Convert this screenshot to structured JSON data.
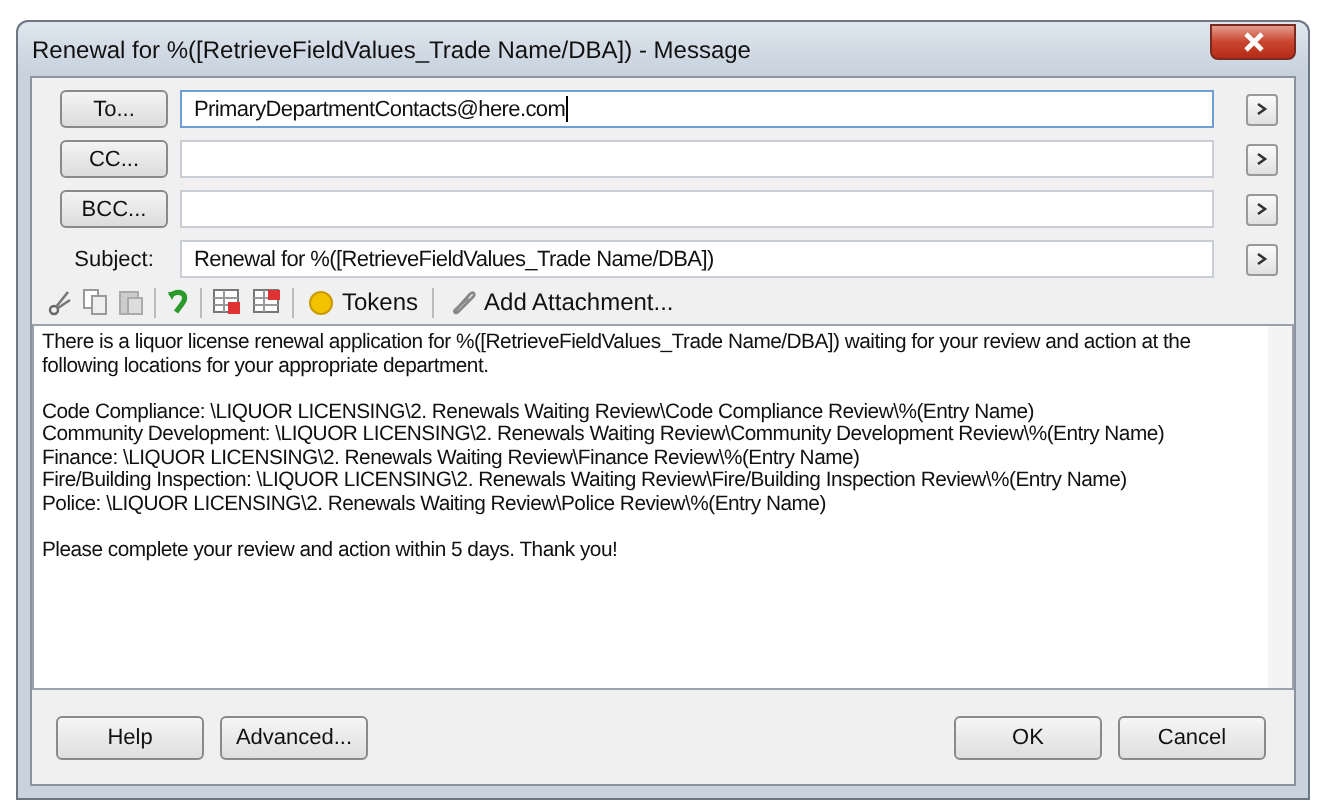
{
  "window": {
    "title": "Renewal for %([RetrieveFieldValues_Trade Name/DBA]) - Message"
  },
  "fields": [
    {
      "kind": "button",
      "label": "To...",
      "value": "PrimaryDepartmentContacts@here.com",
      "focused": true
    },
    {
      "kind": "button",
      "label": "CC...",
      "focused": false
    },
    {
      "kind": "button",
      "label": "BCC...",
      "focused": false
    },
    {
      "kind": "label",
      "label": "Subject:",
      "value": "Renewal for %([RetrieveFieldValues_Trade Name/DBA])",
      "focused": false
    }
  ],
  "toolbar": [
    {
      "kind": "tokens",
      "label": "Tokens"
    },
    {
      "kind": "attach",
      "label": "Add Attachment..."
    }
  ],
  "body": [
    [
      "There is a liquor license renewal application for %([RetrieveFieldValues_Trade Name/DBA]) waiting for your review and action at the following locations for your appropriate department."
    ],
    [
      "Code Compliance: \\LIQUOR LICENSING\\2. Renewals Waiting Review\\Code Compliance Review\\%(Entry Name)",
      "Community Development: \\LIQUOR LICENSING\\2. Renewals Waiting Review\\Community Development Review\\%(Entry Name)",
      "Finance: \\LIQUOR LICENSING\\2. Renewals Waiting Review\\Finance Review\\%(Entry Name)",
      "Fire/Building Inspection: \\LIQUOR LICENSING\\2. Renewals Waiting Review\\Fire/Building Inspection Review\\%(Entry Name)",
      "Police: \\LIQUOR LICENSING\\2. Renewals Waiting Review\\Police Review\\%(Entry Name)"
    ],
    [
      "Please complete your review and action within 5 days.  Thank you!"
    ]
  ],
  "buttons_left": [
    "Help",
    "Advanced..."
  ],
  "buttons_right": [
    "OK",
    "Cancel"
  ]
}
